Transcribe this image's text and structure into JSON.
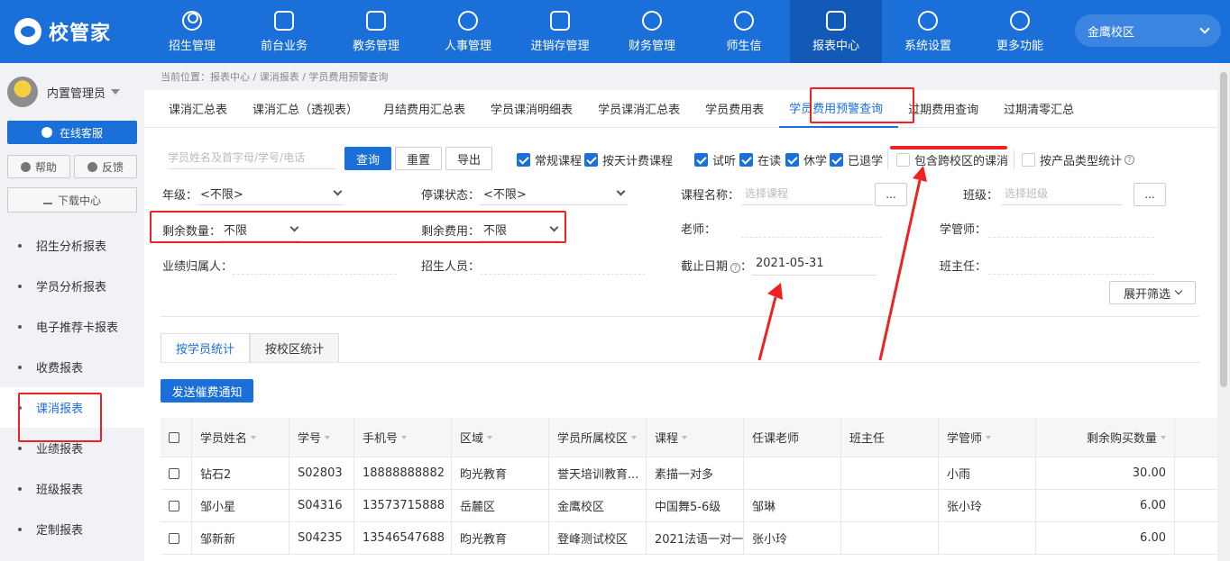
{
  "header": {
    "logo_text": "校管家",
    "nav": [
      {
        "label": "招生管理",
        "icon": "user-add-icon"
      },
      {
        "label": "前台业务",
        "icon": "monitor-icon"
      },
      {
        "label": "教务管理",
        "icon": "book-icon"
      },
      {
        "label": "人事管理",
        "icon": "person-icon"
      },
      {
        "label": "进销存管理",
        "icon": "inventory-icon"
      },
      {
        "label": "财务管理",
        "icon": "money-bag-icon"
      },
      {
        "label": "师生信",
        "icon": "chat-icon"
      },
      {
        "label": "报表中心",
        "icon": "report-icon",
        "active": true
      },
      {
        "label": "系统设置",
        "icon": "settings-icon"
      },
      {
        "label": "更多功能",
        "icon": "more-icon"
      }
    ],
    "campus": "金鹰校区"
  },
  "sidebar": {
    "username": "内置管理员",
    "online_service": "在线客服",
    "help": "帮助",
    "feedback": "反馈",
    "download": "下载中心",
    "menu": [
      {
        "label": "招生分析报表"
      },
      {
        "label": "学员分析报表"
      },
      {
        "label": "电子推荐卡报表"
      },
      {
        "label": "收费报表"
      },
      {
        "label": "课消报表",
        "active": true
      },
      {
        "label": "业绩报表"
      },
      {
        "label": "班级报表"
      },
      {
        "label": "定制报表"
      }
    ]
  },
  "breadcrumb": "当前位置：报表中心 / 课消报表 / 学员费用预警查询",
  "tabs": [
    {
      "label": "课消汇总表"
    },
    {
      "label": "课消汇总（透视表）"
    },
    {
      "label": "月结费用汇总表"
    },
    {
      "label": "学员课消明细表"
    },
    {
      "label": "学员课消汇总表"
    },
    {
      "label": "学员费用表"
    },
    {
      "label": "学员费用预警查询",
      "active": true
    },
    {
      "label": "过期费用查询"
    },
    {
      "label": "过期清零汇总"
    }
  ],
  "filters": {
    "search_placeholder": "学员姓名及首字母/学号/电话",
    "query": "查询",
    "reset": "重置",
    "export": "导出",
    "checkboxes": [
      {
        "label": "常规课程",
        "checked": true
      },
      {
        "label": "按天计费课程",
        "checked": true
      },
      {
        "label": "试听",
        "checked": true
      },
      {
        "label": "在读",
        "checked": true
      },
      {
        "label": "休学",
        "checked": true
      },
      {
        "label": "已退学",
        "checked": true
      },
      {
        "label": "包含跨校区的课消",
        "checked": false
      },
      {
        "label": "按产品类型统计",
        "checked": false
      }
    ],
    "grade_label": "年级：",
    "grade_value": "<不限>",
    "suspend_label": "停课状态：",
    "suspend_value": "<不限>",
    "course_label": "课程名称：",
    "course_placeholder": "选择课程",
    "class_label": "班级：",
    "class_placeholder": "选择班级",
    "dots": "...",
    "remain_qty_label": "剩余数量：",
    "remain_qty_value": "不限",
    "remain_fee_label": "剩余费用：",
    "remain_fee_value": "不限",
    "teacher_label": "老师：",
    "manager_label": "学管师：",
    "perf_label": "业绩归属人：",
    "recruiter_label": "招生人员：",
    "deadline_label": "截止日期",
    "deadline_value": "2021-05-31",
    "head_teacher_label": "班主任：",
    "expand": "展开筛选",
    "colon": "："
  },
  "subtabs": [
    {
      "label": "按学员统计",
      "active": true
    },
    {
      "label": "按校区统计"
    }
  ],
  "send_notice": "发送催费通知",
  "table": {
    "headers": [
      "学员姓名",
      "学号",
      "手机号",
      "区域",
      "学员所属校区",
      "课程",
      "任课老师",
      "班主任",
      "学管师",
      "剩余购买数量"
    ],
    "rows": [
      [
        "钻石2",
        "S02803",
        "18888888882",
        "昀光教育",
        "誉天培训教育...",
        "素描一对多",
        "",
        "",
        "小雨",
        "30.00"
      ],
      [
        "邹小星",
        "S04316",
        "13573715888",
        "岳麓区",
        "金鹰校区",
        "中国舞5-6级",
        "邹琳",
        "",
        "张小玲",
        "6.00"
      ],
      [
        "邹新新",
        "S04235",
        "13546547688",
        "昀光教育",
        "登峰测试校区",
        "2021法语一对一",
        "张小玲",
        "",
        "",
        "6.00"
      ]
    ]
  },
  "colors": {
    "primary": "#1a6fd9",
    "highlight": "#e22222"
  }
}
